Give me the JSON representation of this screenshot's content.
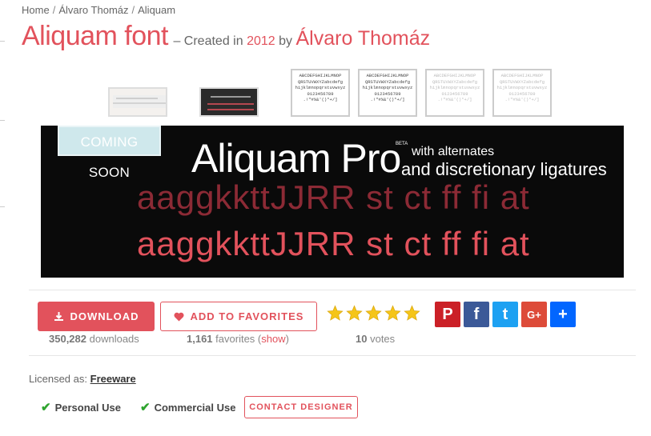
{
  "breadcrumb": {
    "home": "Home",
    "designer": "Álvaro Thomáz",
    "current": "Aliquam"
  },
  "header": {
    "title": "Aliquam font",
    "dash": "– Created in",
    "year": "2012",
    "by": "by",
    "designer": "Álvaro Thomáz"
  },
  "thumbnails": [
    {
      "kind": "preview-light"
    },
    {
      "kind": "preview-dark"
    },
    {
      "lines": [
        "ABCDEFGHIJKLMNOP",
        "QRSTUVWXYZabcdefg",
        "hijklmnopqrstuvwxyz",
        "0123456789",
        ".!\"#%&'()*+/]"
      ]
    },
    {
      "lines": [
        "ABCDEFGHIJKLMNOP",
        "QRSTUVWXYZabcdefg",
        "hijklmnopqrstuvwxyz",
        "0123456789",
        ".!\"#%&'()*+/]"
      ]
    },
    {
      "lines": [
        "ABCDEFGHIJKLMNOP",
        "QRSTUVWXYZabcdefg",
        "hijklmnopqrstuvwxyz",
        "0123456789",
        ".!\"#%&'()*+/]"
      ]
    },
    {
      "lines": [
        "ABCDEFGHIJKLMNOP",
        "QRSTUVWXYZabcdefg",
        "hijklmnopqrstuvwxyz",
        "0123456789",
        ".!\"#%&'()*+/]"
      ]
    }
  ],
  "banner": {
    "badge": "COMING SOON",
    "name": "Aliquam Pro",
    "beta": "BETA",
    "line1": "with alternates",
    "line2": "and discretionary ligatures",
    "sample": "aaggkkttJJRR st ct ff fi at"
  },
  "actions": {
    "download_label": "DOWNLOAD",
    "favorites_label": "ADD TO FAVORITES",
    "downloads_count": "350,282",
    "downloads_word": "downloads",
    "favorites_count": "1,161",
    "favorites_word": "favorites (",
    "show_link": "show",
    "favorites_close": ")",
    "votes_count": "10",
    "votes_word": "votes",
    "rating": 5,
    "rating_max": 5
  },
  "share": [
    {
      "name": "pinterest",
      "glyph": "P",
      "color": "#cb2027"
    },
    {
      "name": "facebook",
      "glyph": "f",
      "color": "#3b5998"
    },
    {
      "name": "twitter",
      "glyph": "t",
      "color": "#1da1f2"
    },
    {
      "name": "google-plus",
      "glyph": "G+",
      "color": "#dd4b39"
    },
    {
      "name": "more",
      "glyph": "+",
      "color": "#0166ff"
    }
  ],
  "license": {
    "prefix": "Licensed as:",
    "type": "Freeware",
    "personal": "Personal Use",
    "commercial": "Commercial Use",
    "contact_label": "CONTACT DESIGNER"
  },
  "colors": {
    "accent": "#e2525c",
    "check": "#2fa42f"
  }
}
